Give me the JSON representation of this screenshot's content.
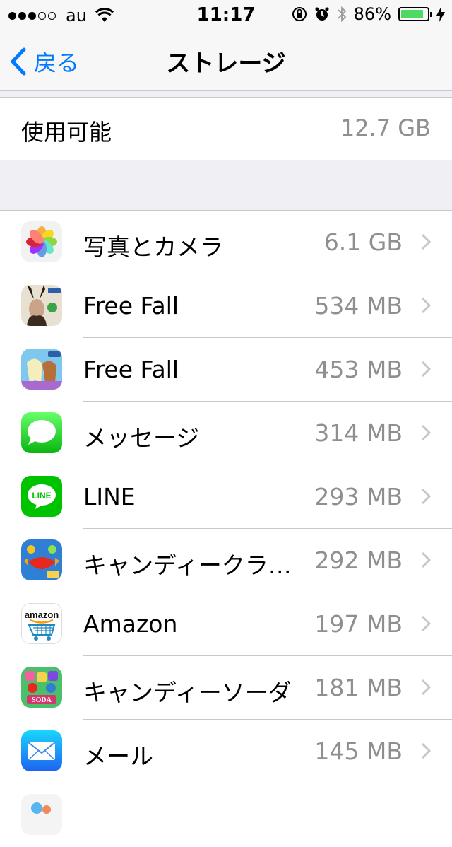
{
  "status_bar": {
    "carrier": "au",
    "time": "11:17",
    "battery_percent": "86%",
    "battery_level": 0.86,
    "signal_strength": 3
  },
  "nav": {
    "back_label": "戻る",
    "title": "ストレージ"
  },
  "available": {
    "label": "使用可能",
    "value": "12.7 GB"
  },
  "apps": [
    {
      "name": "写真とカメラ",
      "size": "6.1 GB",
      "icon": "photos-icon"
    },
    {
      "name": "Free Fall",
      "size": "534 MB",
      "icon": "maleficent-free-fall-icon"
    },
    {
      "name": "Free Fall",
      "size": "453 MB",
      "icon": "frozen-free-fall-icon"
    },
    {
      "name": "メッセージ",
      "size": "314 MB",
      "icon": "messages-icon"
    },
    {
      "name": "LINE",
      "size": "293 MB",
      "icon": "line-icon",
      "icon_text": "LINE"
    },
    {
      "name": "キャンディークラッ…",
      "size": "292 MB",
      "icon": "candy-crush-icon"
    },
    {
      "name": "Amazon",
      "size": "197 MB",
      "icon": "amazon-icon",
      "icon_text": "amazon"
    },
    {
      "name": "キャンディーソーダ",
      "size": "181 MB",
      "icon": "candy-crush-soda-icon",
      "icon_text": "SODA"
    },
    {
      "name": "メール",
      "size": "145 MB",
      "icon": "mail-icon"
    }
  ],
  "colors": {
    "accent": "#007aff",
    "battery": "#4cd964",
    "secondary_text": "#8e8e93"
  }
}
